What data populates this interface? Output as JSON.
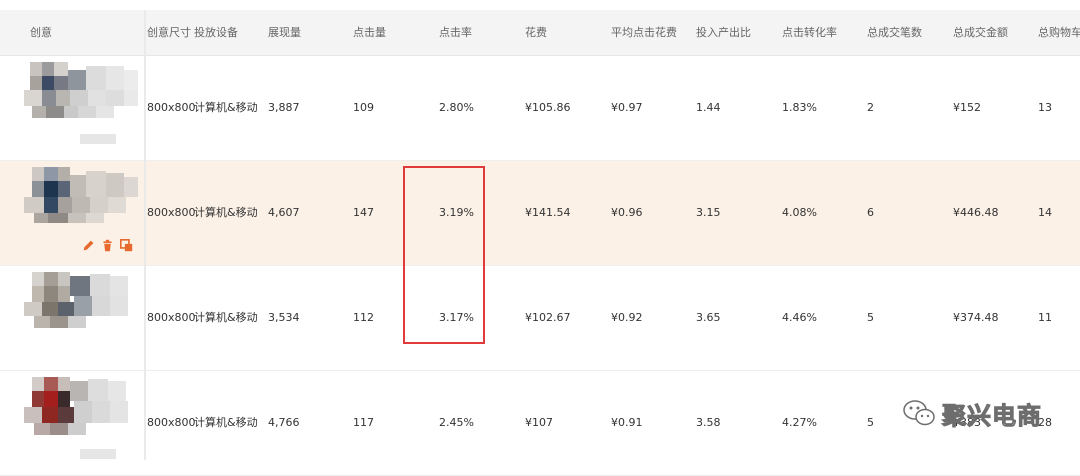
{
  "header": {
    "columns": [
      "创意",
      "创意尺寸",
      "投放设备",
      "展现量",
      "点击量",
      "点击率",
      "花费",
      "平均点击花费",
      "投入产出比",
      "点击转化率",
      "总成交笔数",
      "总成交金额",
      "总购物车数"
    ]
  },
  "rows": [
    {
      "size": "800x800",
      "device": "计算机&移动",
      "impressions": "3,887",
      "clicks": "109",
      "ctr": "2.80%",
      "cost": "¥105.86",
      "avg_cpc": "¥0.97",
      "roi": "1.44",
      "cvr": "1.83%",
      "orders": "2",
      "gmv": "¥152",
      "cart": "13"
    },
    {
      "size": "800x800",
      "device": "计算机&移动",
      "impressions": "4,607",
      "clicks": "147",
      "ctr": "3.19%",
      "cost": "¥141.54",
      "avg_cpc": "¥0.96",
      "roi": "3.15",
      "cvr": "4.08%",
      "orders": "6",
      "gmv": "¥446.48",
      "cart": "14"
    },
    {
      "size": "800x800",
      "device": "计算机&移动",
      "impressions": "3,534",
      "clicks": "112",
      "ctr": "3.17%",
      "cost": "¥102.67",
      "avg_cpc": "¥0.92",
      "roi": "3.65",
      "cvr": "4.46%",
      "orders": "5",
      "gmv": "¥374.48",
      "cart": "11"
    },
    {
      "size": "800x800",
      "device": "计算机&移动",
      "impressions": "4,766",
      "clicks": "117",
      "ctr": "2.45%",
      "cost": "¥107",
      "avg_cpc": "¥0.91",
      "roi": "3.58",
      "cvr": "4.27%",
      "orders": "5",
      "gmv": "¥383",
      "cart": "28"
    }
  ],
  "icons": {
    "edit": "pencil-icon",
    "delete": "trash-icon",
    "copy": "copy-icon"
  },
  "colors": {
    "header_bg": "#f4f4f4",
    "active_row_bg": "#fbf1e7",
    "action_icon": "#e8692e",
    "highlight_border": "#e03a3a"
  },
  "watermark": {
    "text": "聚兴电商"
  }
}
